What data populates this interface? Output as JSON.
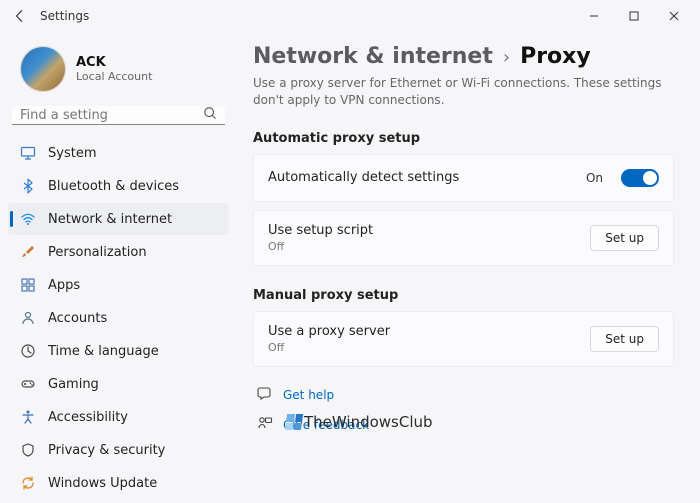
{
  "window": {
    "title": "Settings"
  },
  "profile": {
    "name": "ACK",
    "sub": "Local Account"
  },
  "search": {
    "placeholder": "Find a setting"
  },
  "sidebar": {
    "items": [
      {
        "icon": "monitor-icon",
        "label": "System",
        "selected": false,
        "color": "#3a7bbf"
      },
      {
        "icon": "bluetooth-icon",
        "label": "Bluetooth & devices",
        "selected": false,
        "color": "#2e7bd6"
      },
      {
        "icon": "wifi-icon",
        "label": "Network & internet",
        "selected": true,
        "color": "#1f8fe0"
      },
      {
        "icon": "brush-icon",
        "label": "Personalization",
        "selected": false,
        "color": "#c77a3a"
      },
      {
        "icon": "grid-icon",
        "label": "Apps",
        "selected": false,
        "color": "#4b79b7"
      },
      {
        "icon": "person-icon",
        "label": "Accounts",
        "selected": false,
        "color": "#5a7a8a"
      },
      {
        "icon": "clock-icon",
        "label": "Time & language",
        "selected": false,
        "color": "#4a4a4a"
      },
      {
        "icon": "gamepad-icon",
        "label": "Gaming",
        "selected": false,
        "color": "#4a4a4a"
      },
      {
        "icon": "accessibility-icon",
        "label": "Accessibility",
        "selected": false,
        "color": "#3a6fb8"
      },
      {
        "icon": "shield-icon",
        "label": "Privacy & security",
        "selected": false,
        "color": "#4a4a4a"
      },
      {
        "icon": "update-icon",
        "label": "Windows Update",
        "selected": false,
        "color": "#d98c2b"
      }
    ]
  },
  "breadcrumb": {
    "parent": "Network & internet",
    "current": "Proxy"
  },
  "description": "Use a proxy server for Ethernet or Wi-Fi connections. These settings don't apply to VPN connections.",
  "sections": {
    "auto_title": "Automatic proxy setup",
    "manual_title": "Manual proxy setup"
  },
  "auto_detect": {
    "label": "Automatically detect settings",
    "state": "On"
  },
  "setup_script": {
    "label": "Use setup script",
    "sub": "Off",
    "button": "Set up"
  },
  "manual_proxy": {
    "label": "Use a proxy server",
    "sub": "Off",
    "button": "Set up"
  },
  "links": {
    "help": "Get help",
    "feedback": "Give feedback"
  },
  "watermark": "TheWindowsClub"
}
